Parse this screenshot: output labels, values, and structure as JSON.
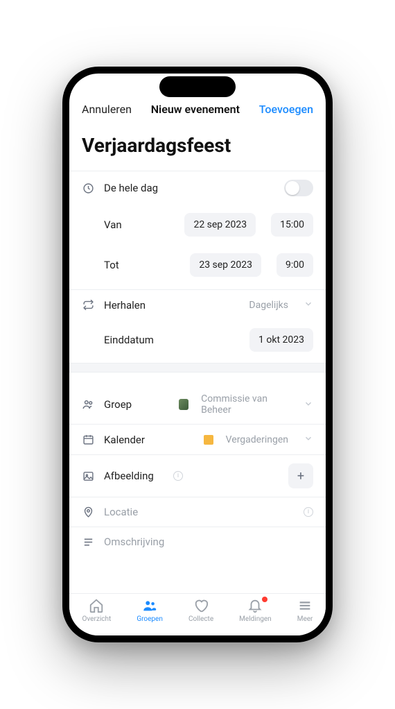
{
  "header": {
    "cancel": "Annuleren",
    "title": "Nieuw evenement",
    "add": "Toevoegen"
  },
  "event": {
    "title": "Verjaardagsfeest"
  },
  "allday": {
    "label": "De hele dag"
  },
  "from": {
    "label": "Van",
    "date": "22 sep 2023",
    "time": "15:00"
  },
  "to": {
    "label": "Tot",
    "date": "23 sep 2023",
    "time": "9:00"
  },
  "repeat": {
    "label": "Herhalen",
    "value": "Dagelijks"
  },
  "enddate": {
    "label": "Einddatum",
    "value": "1 okt 2023"
  },
  "group": {
    "label": "Groep",
    "value": "Commissie van Beheer"
  },
  "calendar": {
    "label": "Kalender",
    "value": "Vergaderingen"
  },
  "image": {
    "label": "Afbeelding"
  },
  "location": {
    "label": "Locatie"
  },
  "description": {
    "label": "Omschrijving"
  },
  "tabs": {
    "overview": "Overzicht",
    "groups": "Groepen",
    "collect": "Collecte",
    "notifications": "Meldingen",
    "more": "Meer"
  }
}
